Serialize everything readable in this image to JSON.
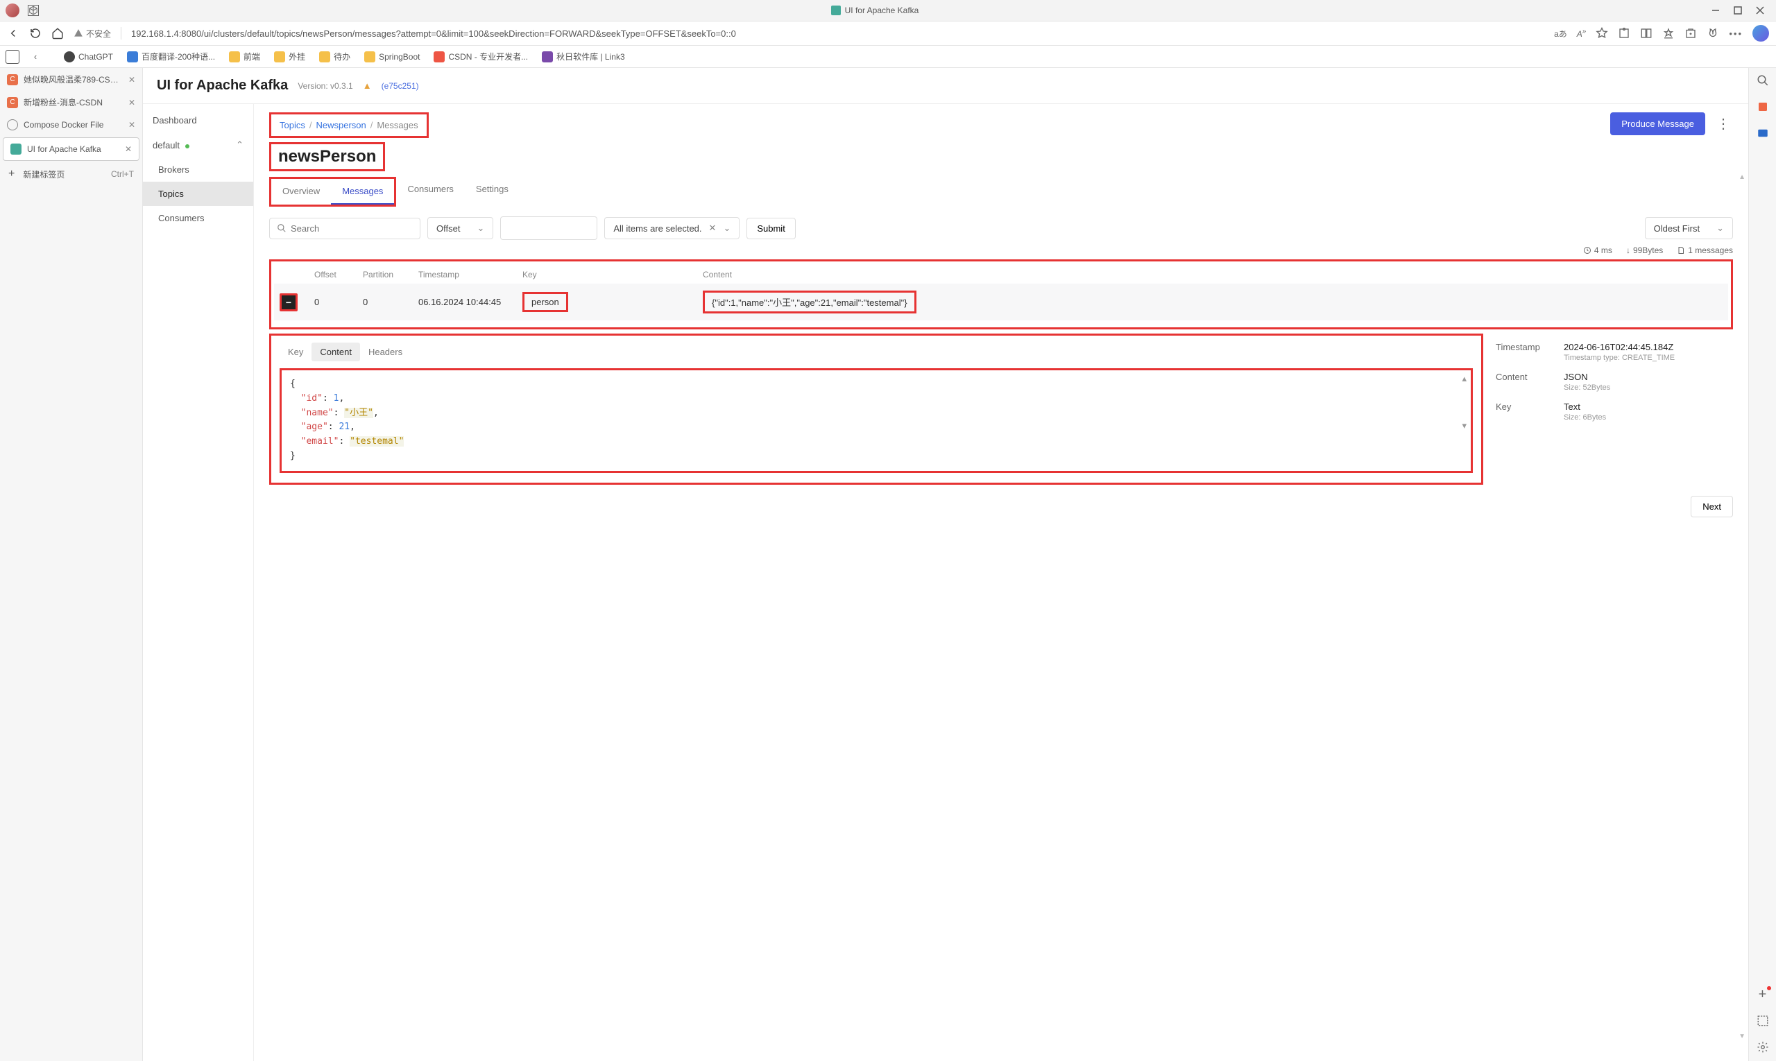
{
  "titlebar": {
    "page_title": "UI for Apache Kafka"
  },
  "urlbar": {
    "insecure_label": "不安全",
    "url": "192.168.1.4:8080/ui/clusters/default/topics/newsPerson/messages?attempt=0&limit=100&seekDirection=FORWARD&seekType=OFFSET&seekTo=0::0",
    "translate": "aあ"
  },
  "bookmarks": [
    {
      "label": "ChatGPT",
      "ico": "chat"
    },
    {
      "label": "百度翻译-200种语...",
      "ico": "fanyi"
    },
    {
      "label": "前端",
      "ico": "folder"
    },
    {
      "label": "外挂",
      "ico": "folder"
    },
    {
      "label": "待办",
      "ico": "folder"
    },
    {
      "label": "SpringBoot",
      "ico": "folder"
    },
    {
      "label": "CSDN - 专业开发者...",
      "ico": "csdn"
    },
    {
      "label": "秋日软件库 | Link3",
      "ico": "qiuri"
    }
  ],
  "pane_tabs": [
    {
      "label": "她似晚风般温柔789-CSDN博客",
      "ico": "csdn"
    },
    {
      "label": "新增粉丝-消息-CSDN",
      "ico": "csdn"
    },
    {
      "label": "Compose Docker File",
      "ico": "gear"
    },
    {
      "label": "UI for Apache Kafka",
      "ico": "kafka",
      "active": true
    }
  ],
  "newtab": {
    "label": "新建标签页",
    "shortcut": "Ctrl+T"
  },
  "kafka": {
    "app_name": "UI for Apache Kafka",
    "version_label": "Version: v0.3.1",
    "commit_hash": "(e75c251)",
    "sidebar": {
      "dashboard": "Dashboard",
      "cluster": "default",
      "brokers": "Brokers",
      "topics": "Topics",
      "consumers": "Consumers"
    },
    "crumbs": {
      "topics": "Topics",
      "name": "Newsperson",
      "messages": "Messages"
    },
    "topic_title": "newsPerson",
    "produce_btn": "Produce Message",
    "tabs": {
      "overview": "Overview",
      "messages": "Messages",
      "consumers": "Consumers",
      "settings": "Settings"
    },
    "search_placeholder": "Search",
    "offset_sel": "Offset",
    "filter_sel": "All items are selected.",
    "submit": "Submit",
    "sort_sel": "Oldest First",
    "stats": {
      "time": "4 ms",
      "size": "99Bytes",
      "count": "1 messages"
    },
    "table": {
      "headers": {
        "offset": "Offset",
        "partition": "Partition",
        "ts": "Timestamp",
        "key": "Key",
        "content": "Content"
      },
      "row": {
        "offset": "0",
        "partition": "0",
        "ts": "06.16.2024 10:44:45",
        "key": "person",
        "content": "{\"id\":1,\"name\":\"小王\",\"age\":21,\"email\":\"testemal\"}"
      }
    },
    "detail": {
      "tabs": {
        "key": "Key",
        "content": "Content",
        "headers": "Headers"
      },
      "json": {
        "id": 1,
        "name": "小王",
        "age": 21,
        "email": "testemal"
      },
      "meta": {
        "ts_label": "Timestamp",
        "ts_val": "2024-06-16T02:44:45.184Z",
        "ts_sub": "Timestamp type: CREATE_TIME",
        "content_label": "Content",
        "content_val": "JSON",
        "content_sub": "Size: 52Bytes",
        "key_label": "Key",
        "key_val": "Text",
        "key_sub": "Size: 6Bytes"
      }
    },
    "next": "Next"
  }
}
